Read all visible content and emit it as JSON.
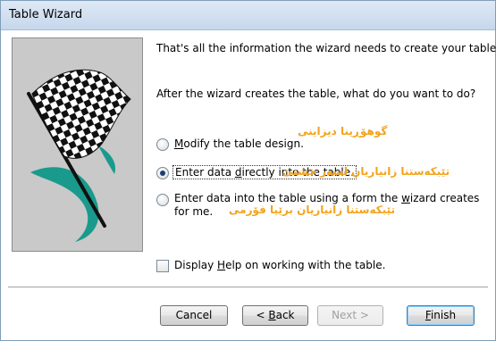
{
  "window": {
    "title": "Table Wizard"
  },
  "intro": {
    "line1": "That's all the information the wizard needs to create your table.",
    "line2": "After the wizard creates the table, what do you want to do?"
  },
  "options": [
    {
      "pre": "",
      "accel": "M",
      "post": "odify the table design.",
      "checked": false,
      "annotation": "گوهۆڕینا دیزاینی"
    },
    {
      "pre": "Enter data ",
      "accel": "d",
      "post": "irectly into the table.",
      "checked": true,
      "annotation": "تێبکەستنا زانیاریان لسەر خشتێ"
    },
    {
      "line1_pre": "Enter data into the table using a form the ",
      "line1_accel": "w",
      "line1_post": "izard creates",
      "line2": "for me.",
      "checked": false,
      "annotation": "تێبکەستنا زانیاریان برێیا فۆرمی"
    }
  ],
  "help_checkbox": {
    "pre": "Display ",
    "accel": "H",
    "post": "elp on working with the table.",
    "checked": false
  },
  "buttons": {
    "cancel": "Cancel",
    "back_pre": "< ",
    "back_accel": "B",
    "back_post": "ack",
    "next": "Next >",
    "finish_accel": "F",
    "finish_post": "inish"
  },
  "colors": {
    "annotation": "#f3a31b",
    "title_bar": "#c6d7ec",
    "art_background": "#c9c9c9",
    "teal_accent": "#1a9a8c"
  },
  "icons": {
    "art": "checkered-flag-icon"
  }
}
